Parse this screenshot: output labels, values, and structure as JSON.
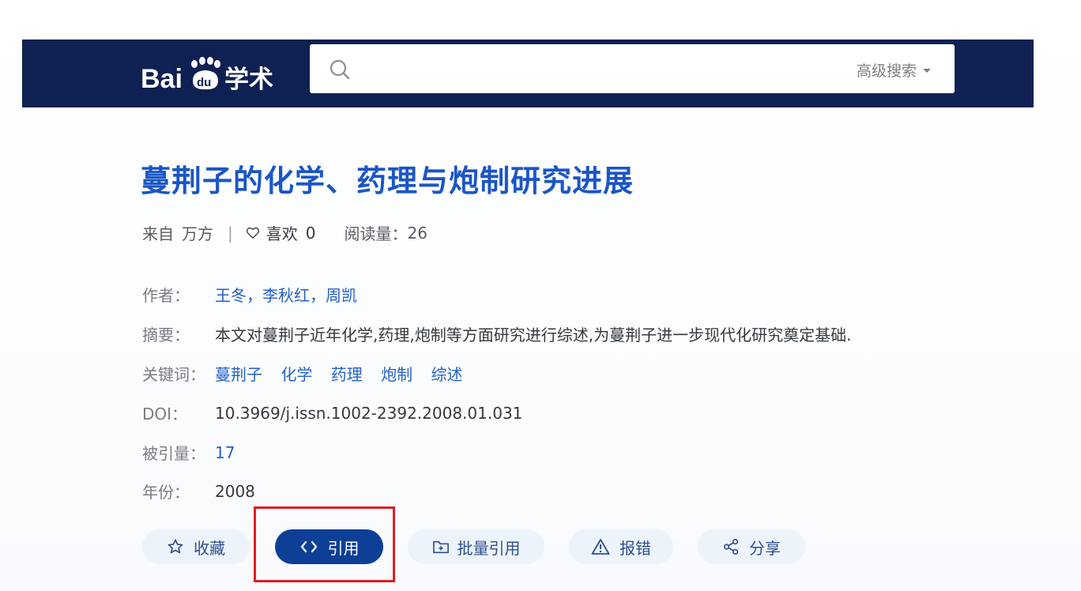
{
  "header": {
    "logo_text": "Bai du 学术",
    "search": {
      "placeholder": "",
      "advanced_label": "高级搜索"
    }
  },
  "paper": {
    "title": "蔓荆子的化学、药理与炮制研究进展",
    "source_prefix": "来自",
    "source": "万方",
    "separator": "|",
    "likes_label": "喜欢",
    "likes_count": "0",
    "reads_label": "阅读量：",
    "reads_count": "26"
  },
  "info": {
    "authors_label": "作者：",
    "authors": [
      "王冬",
      "李秋红",
      "周凯"
    ],
    "author_sep": "，",
    "abstract_label": "摘要：",
    "abstract": "本文对蔓荆子近年化学,药理,炮制等方面研究进行综述,为蔓荆子进一步现代化研究奠定基础.",
    "keywords_label": "关键词：",
    "keywords": [
      "蔓荆子",
      "化学",
      "药理",
      "炮制",
      "综述"
    ],
    "doi_label": "DOI：",
    "doi": "10.3969/j.issn.1002-2392.2008.01.031",
    "cited_label": "被引量：",
    "cited": "17",
    "year_label": "年份：",
    "year": "2008"
  },
  "actions": {
    "collect": "收藏",
    "cite": "引用",
    "batch_cite": "批量引用",
    "report": "报错",
    "share": "分享"
  },
  "colors": {
    "header_bg": "#0e2152",
    "title": "#1a56c6",
    "link": "#2561c8",
    "primary_button": "#0d3f96",
    "highlight": "#e21d23"
  }
}
